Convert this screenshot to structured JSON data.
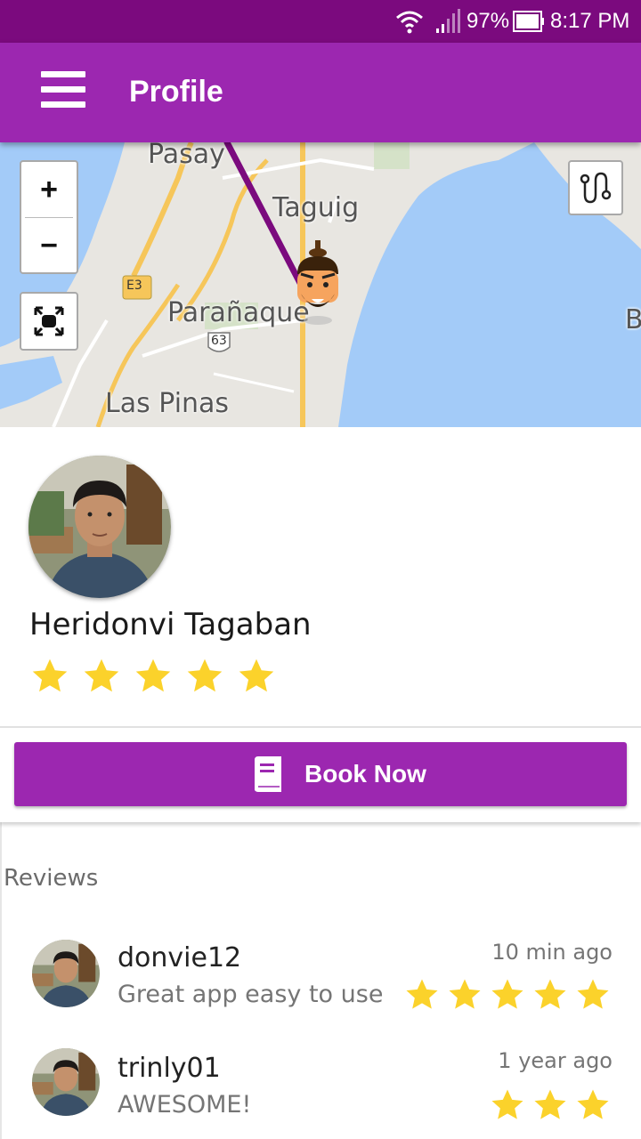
{
  "status_bar": {
    "battery": "97%",
    "time": "8:17 PM",
    "icons": [
      "wifi-icon",
      "signal-icon",
      "battery-icon"
    ]
  },
  "app_bar": {
    "title": "Profile",
    "menu_icon": "hamburger-menu-icon",
    "color": "#9c27b0"
  },
  "map": {
    "labels": {
      "pasay": "Pasay",
      "taguig": "Taguig",
      "paranaque": "Parañaque",
      "las_pinas": "Las Pinas",
      "edge_b": "B",
      "road_e3": "E3",
      "road_63": "63"
    },
    "controls": {
      "zoom_in": "+",
      "zoom_out": "−",
      "fit_icon": "fit-to-screen-icon",
      "route_icon": "route-icon"
    },
    "marker_icon": "driver-avatar-marker-icon",
    "route_color": "#7b0a7e",
    "water_color": "#a3cbf8"
  },
  "profile": {
    "name": "Heridonvi Tagaban",
    "rating": 5,
    "rating_max": 5,
    "star_color": "#fbd22b"
  },
  "book": {
    "label": "Book Now",
    "icon": "book-icon"
  },
  "reviews": {
    "title": "Reviews",
    "items": [
      {
        "user": "donvie12",
        "text": "Great app easy to use",
        "time": "10 min ago",
        "rating": 5
      },
      {
        "user": "trinly01",
        "text": "AWESOME!",
        "time": "1 year ago",
        "rating": 3
      }
    ]
  }
}
